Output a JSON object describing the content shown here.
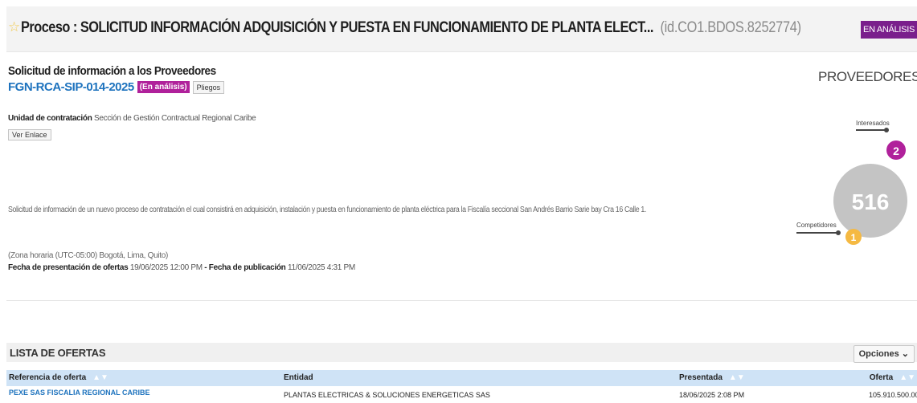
{
  "header": {
    "title": "Proceso : SOLICITUD INFORMACIÓN ADQUISICIÓN Y PUESTA EN FUNCIONAMIENTO  DE PLANTA ELECT...",
    "id": "(id.CO1.BDOS.8252774)",
    "status": "EN ANÁLISIS"
  },
  "summary": {
    "title": "Solicitud de información a los Proveedores",
    "reference": "FGN-RCA-SIP-014-2025",
    "badge": "(En análisis)",
    "pliegos_label": "Pliegos",
    "unit_label": "Unidad de contratación",
    "unit_value": "Sección de Gestión Contractual Regional Caribe",
    "ver_enlace_label": "Ver Enlace",
    "description": "Solicitud de información de un nuevo proceso de contratación el cual consistirá en adquisición, instalación y puesta en funcionamiento de planta eléctrica para la Fiscalía seccional San Andrés Barrio Sarie bay Cra 16 Calle 1.",
    "timezone": "(Zona horaria (UTC-05:00) Bogotá, Lima, Quito)",
    "presentation_label": "Fecha de presentación de ofertas",
    "presentation_value": "19/06/2025 12:00 PM",
    "separator": "-",
    "publication_label": "Fecha de publicación",
    "publication_value": "11/06/2025 4:31 PM"
  },
  "providers": {
    "title": "PROVEEDORES",
    "total": "516",
    "interested_label": "Interesados",
    "interested_count": "2",
    "competitors_label": "Competidores",
    "competitors_count": "1",
    "colors": {
      "total": "#c4c4c4",
      "interested": "#b0219b",
      "competitors": "#f5b942"
    }
  },
  "offers": {
    "title": "LISTA DE OFERTAS",
    "options_label": "Opciones",
    "columns": {
      "reference": "Referencia de oferta",
      "entity": "Entidad",
      "submitted": "Presentada",
      "offer": "Oferta"
    },
    "rows": [
      {
        "reference": "PEXE SAS FISCALIA REGIONAL CARIBE",
        "entity": "PLANTAS ELECTRICAS & SOLUCIONES ENERGETICAS SAS",
        "submitted": "18/06/2025 2:08 PM",
        "offer": "105.910.500.000"
      }
    ]
  }
}
